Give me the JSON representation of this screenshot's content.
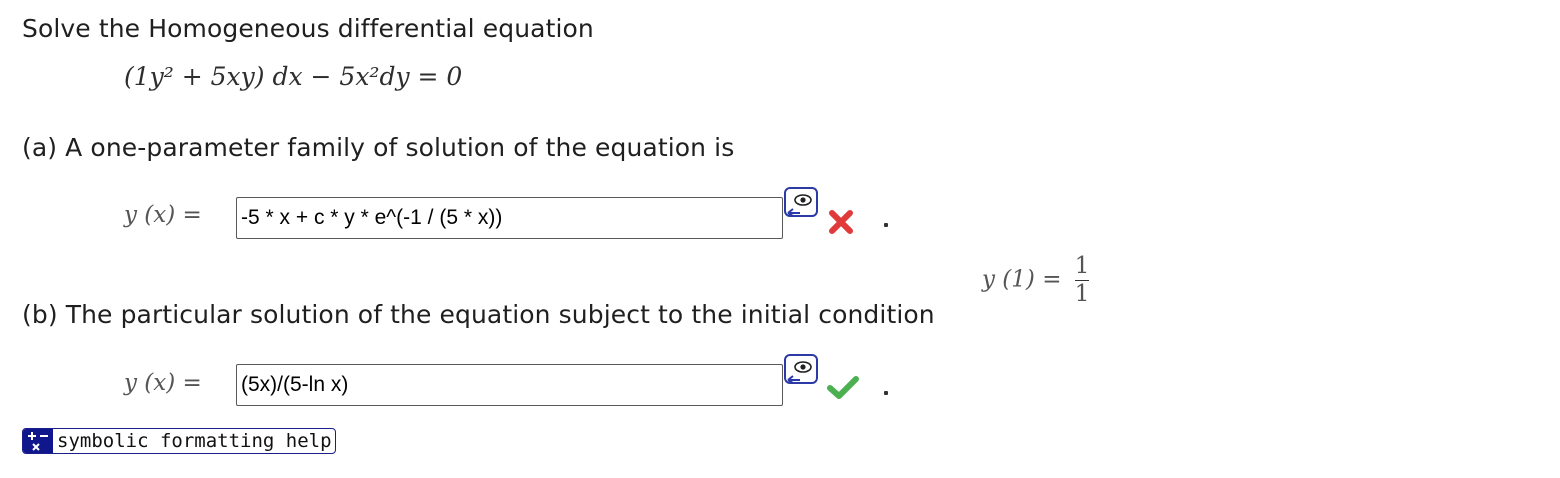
{
  "problem": {
    "intro": "Solve the Homogeneous differential equation",
    "equation": "(1y² + 5xy) dx − 5x²dy = 0"
  },
  "part_a": {
    "prompt": "(a) A one-parameter family of solution of the equation is",
    "lhs": "y (x) =",
    "answer_value": "-5 * x + c * y * e^(-1 / (5 * x))",
    "status": "incorrect",
    "status_color": "#e03a3a"
  },
  "part_b": {
    "prompt": "(b) The particular solution of the equation subject to the initial condition",
    "condition_lhs": "y (1) =",
    "condition_num": "1",
    "condition_den": "1",
    "lhs": "y (x) =",
    "answer_value": "(5x)/(5-ln x)",
    "status": "correct",
    "status_color": "#4caf50"
  },
  "help_button": {
    "label": "symbolic formatting help",
    "icon": "plus-minus-times-icon"
  },
  "icons": {
    "preview": "eye-preview-icon",
    "incorrect": "x-mark-icon",
    "correct": "check-mark-icon"
  }
}
